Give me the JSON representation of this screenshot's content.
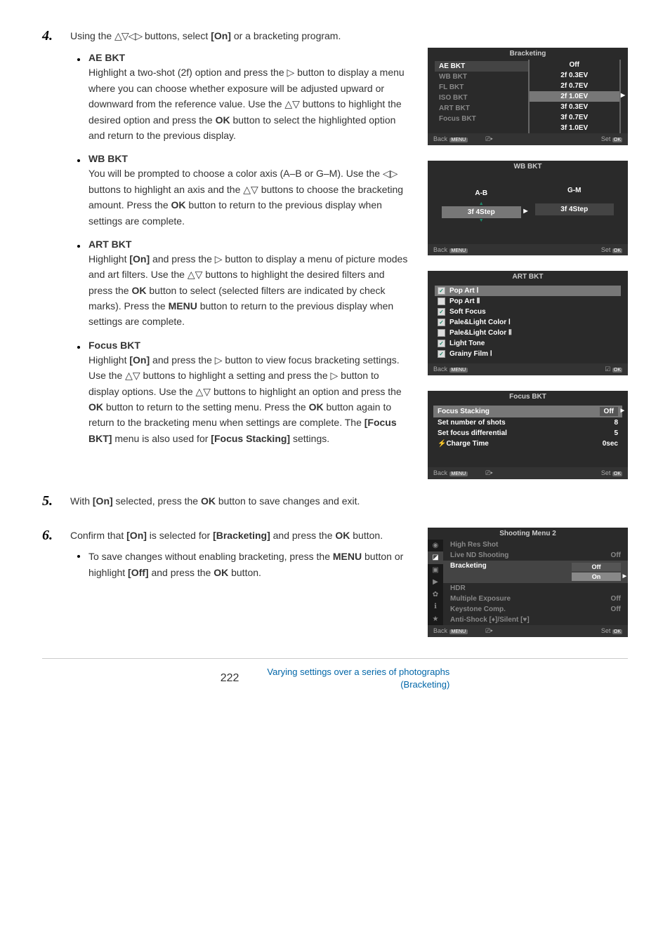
{
  "step4": {
    "intro_pre": "Using the ",
    "intro_mid": " buttons, select ",
    "intro_on": "[On]",
    "intro_post": " or a bracketing program.",
    "items": [
      {
        "title": "AE BKT",
        "desc_parts": [
          "Highlight a two-shot (2f) option and press the ▷ button to display a menu where you can choose whether exposure will be adjusted upward or downward from the reference value. Use the △▽ buttons to highlight the desired option and press the ",
          "OK",
          " button to select the highlighted option and return to the previous display."
        ]
      },
      {
        "title": "WB BKT",
        "desc_parts": [
          "You will be prompted to choose a color axis (A–B or G–M). Use the ◁▷ buttons to highlight an axis and the △▽ buttons to choose the bracketing amount. Press the ",
          "OK",
          " button to return to the previous display when settings are complete."
        ]
      },
      {
        "title": "ART BKT",
        "desc_parts": [
          "Highlight ",
          "[On]",
          " and press the ▷ button to display a menu of picture modes and art filters. Use the △▽ buttons to highlight the desired filters and press the ",
          "OK",
          " button to select (selected filters are indicated by check marks). Press the ",
          "MENU",
          " button to return to the previous display when settings are complete."
        ]
      },
      {
        "title": "Focus BKT",
        "desc_parts": [
          "Highlight ",
          "[On]",
          " and press the ▷ button to view focus bracketing settings. Use the △▽ buttons to highlight a setting and press the ▷ button to display options. Use the △▽ buttons to highlight an option and press the ",
          "OK",
          " button to return to the setting menu. Press the ",
          "OK",
          " button again to return to the bracketing menu when settings are complete. The ",
          "[Focus BKT]",
          " menu is also used for ",
          "[Focus Stacking]",
          " settings."
        ]
      }
    ]
  },
  "step5": {
    "text_pre": "With ",
    "text_on": "[On]",
    "text_mid": " selected, press the ",
    "text_ok": "OK",
    "text_post": " button to save changes and exit."
  },
  "step6": {
    "text_pre": "Confirm that ",
    "text_on": "[On]",
    "text_mid": " is selected for ",
    "text_brkt": "[Bracketing]",
    "text_mid2": " and press the ",
    "text_ok": "OK",
    "text_post": " button.",
    "sub_pre": "To save changes without enabling bracketing, press the ",
    "sub_menu": "MENU",
    "sub_mid": " button or highlight ",
    "sub_off": "[Off]",
    "sub_mid2": " and press the ",
    "sub_ok": "OK",
    "sub_post": " button."
  },
  "screens": {
    "bracketing": {
      "title": "Bracketing",
      "list": [
        "AE BKT",
        "WB BKT",
        "FL BKT",
        "ISO BKT",
        "ART BKT",
        "Focus BKT"
      ],
      "values": [
        "Off",
        "2f 0.3EV",
        "2f 0.7EV",
        "2f 1.0EV",
        "3f 0.3EV",
        "3f 0.7EV",
        "3f 1.0EV"
      ],
      "highlight_idx": 3,
      "footer_back": "Back",
      "footer_set": "Set"
    },
    "wbbkt": {
      "title": "WB BKT",
      "col1_label": "A-B",
      "col1_val": "3f 4Step",
      "col2_label": "G-M",
      "col2_val": "3f 4Step",
      "footer_back": "Back",
      "footer_set": "Set"
    },
    "artbkt": {
      "title": "ART BKT",
      "items": [
        {
          "label": "Pop Art Ⅰ",
          "checked": true,
          "sel": true
        },
        {
          "label": "Pop Art Ⅱ",
          "checked": false,
          "sel": false
        },
        {
          "label": "Soft Focus",
          "checked": true,
          "sel": false
        },
        {
          "label": "Pale&Light Color Ⅰ",
          "checked": true,
          "sel": false
        },
        {
          "label": "Pale&Light Color Ⅱ",
          "checked": false,
          "sel": false
        },
        {
          "label": "Light Tone",
          "checked": true,
          "sel": false
        },
        {
          "label": "Grainy Film Ⅰ",
          "checked": true,
          "sel": false
        }
      ],
      "footer_back": "Back"
    },
    "focusbkt": {
      "title": "Focus BKT",
      "rows": [
        {
          "label": "Focus Stacking",
          "val": "Off",
          "sel": true
        },
        {
          "label": "Set number of shots",
          "val": "8",
          "sel": false
        },
        {
          "label": "Set focus differential",
          "val": "5",
          "sel": false
        },
        {
          "label": "⚡Charge Time",
          "val": "0sec",
          "sel": false
        }
      ],
      "footer_back": "Back",
      "footer_set": "Set"
    },
    "menu2": {
      "title": "Shooting Menu 2",
      "rows": [
        {
          "label": "High Res Shot",
          "val": ""
        },
        {
          "label": "Live ND Shooting",
          "val": "Off"
        },
        {
          "label": "Bracketing",
          "val": "",
          "active": true,
          "opts": [
            "Off",
            "On"
          ],
          "sel_opt": 1
        },
        {
          "label": "HDR",
          "val": ""
        },
        {
          "label": "Multiple Exposure",
          "val": "Off"
        },
        {
          "label": "Keystone Comp.",
          "val": "Off"
        },
        {
          "label": "Anti-Shock [♦]/Silent [♥]",
          "val": ""
        }
      ],
      "footer_back": "Back",
      "footer_set": "Set"
    }
  },
  "footer": {
    "page": "222",
    "ref_line1": "Varying settings over a series of photographs",
    "ref_line2": "(Bracketing)"
  }
}
